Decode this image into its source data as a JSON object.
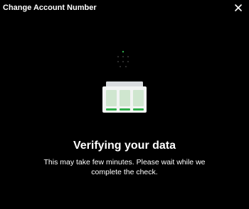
{
  "modal": {
    "title": "Change Account Number",
    "close_icon": "close-icon"
  },
  "status": {
    "heading": "Verifying your data",
    "description": "This may take few minutes. Please wait while we complete the check.",
    "loader_icon": "loading-dots-icon",
    "illustration_icon": "data-table-illustration-icon"
  },
  "colors": {
    "background": "#000000",
    "text": "#ffffff",
    "accent_green": "#2fae4a",
    "illustration_panel": "#e8f3e8",
    "loader_dim": "#3a3a3a"
  }
}
